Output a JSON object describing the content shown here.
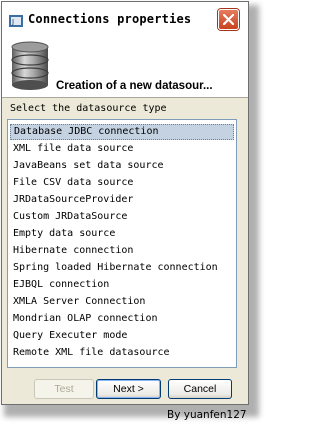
{
  "window": {
    "title": "Connections properties"
  },
  "header": {
    "title": "Creation of a new datasour..."
  },
  "section_label": "Select the datasource type",
  "datasource_types": [
    "Database JDBC connection",
    "XML file data source",
    "JavaBeans set data source",
    "File CSV data source",
    "JRDataSourceProvider",
    "Custom JRDataSource",
    "Empty data source",
    "Hibernate connection",
    "Spring loaded Hibernate connection",
    "EJBQL connection",
    "XMLA Server Connection",
    "Mondrian OLAP connection",
    "Query Executer mode",
    "Remote XML file datasource"
  ],
  "selected_index": 0,
  "buttons": {
    "test": "Test",
    "next": "Next >",
    "cancel": "Cancel"
  },
  "watermark": "By yuanfen127",
  "colors": {
    "selection": "#c4d2e2",
    "dialog_bg": "#ece9d8",
    "close_button": "#c8421f"
  }
}
